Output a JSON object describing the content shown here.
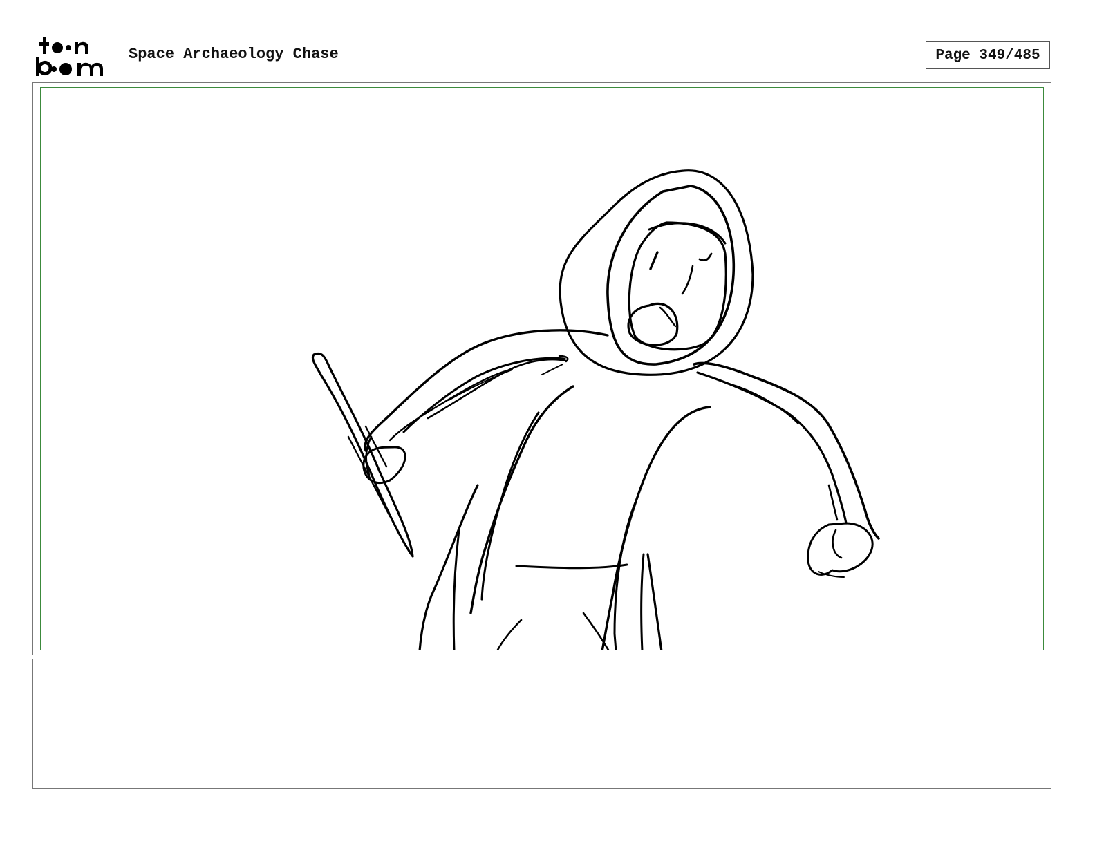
{
  "header": {
    "logo_text_top": "toon",
    "logo_text_bottom": "boom",
    "title": "Space Archaeology Chase",
    "page_counter": "Page 349/485"
  },
  "panel": {
    "sketch_subject": "hooded-figure-with-sword-icon"
  },
  "notes": {
    "text": ""
  },
  "colors": {
    "frame_border": "#777777",
    "safe_area_border": "#3c8a3c",
    "ink": "#000000"
  }
}
